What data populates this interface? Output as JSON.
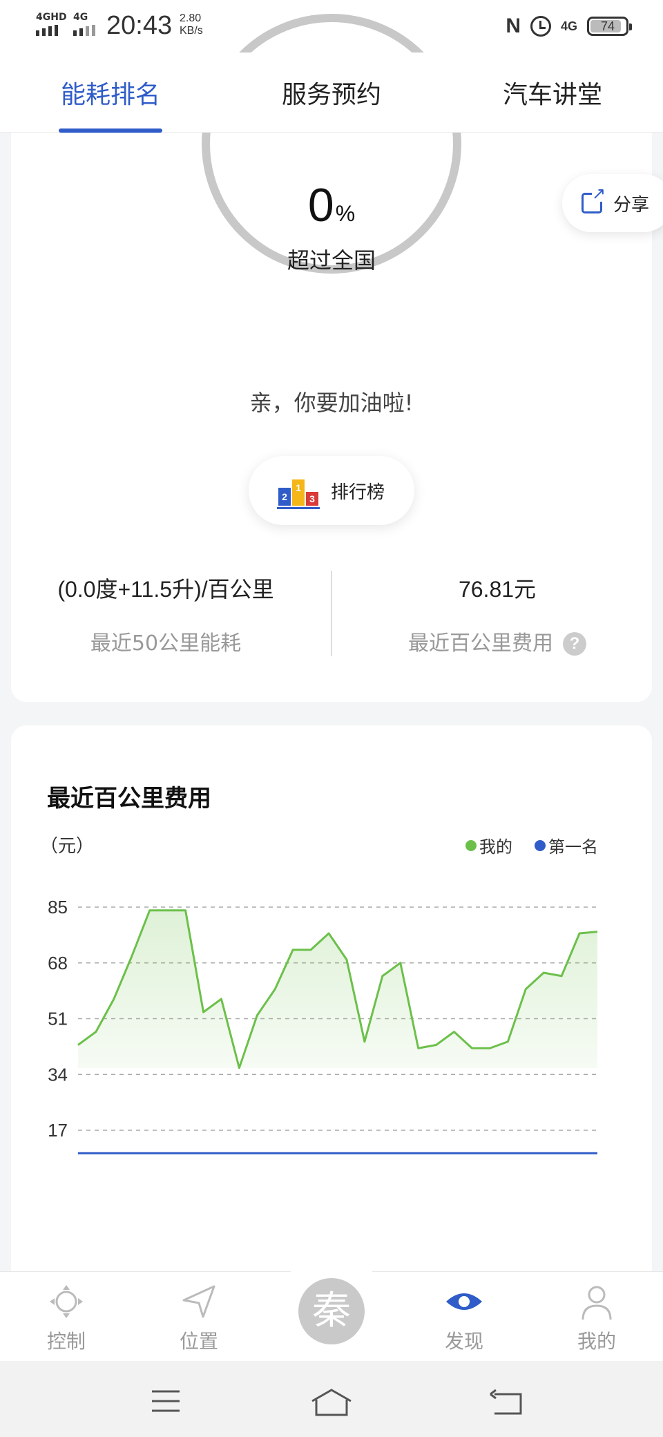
{
  "status_bar": {
    "net1": "4GHD",
    "net2": "4G",
    "time": "20:43",
    "speed_value": "2.80",
    "speed_unit": "KB/s",
    "net3": "4G",
    "battery": "74"
  },
  "tabs": [
    {
      "label": "能耗排名",
      "active": true
    },
    {
      "label": "服务预约",
      "active": false
    },
    {
      "label": "汽车讲堂",
      "active": false
    }
  ],
  "rank": {
    "percent": "0",
    "percent_sign": "%",
    "label": "超过全国",
    "progress_fraction": 0,
    "encourage": "亲，你要加油啦!"
  },
  "share": {
    "label": "分享",
    "icon": "share-icon"
  },
  "leaderboard": {
    "label": "排行榜",
    "icon": "podium-icon",
    "podium": [
      "2",
      "1",
      "3"
    ]
  },
  "stats": {
    "consumption_value": "(0.0度+11.5升)/百公里",
    "consumption_label": "最近50公里能耗",
    "cost_value": "76.81元",
    "cost_label": "最近百公里费用",
    "help_icon": "?"
  },
  "chart_section": {
    "title": "最近百公里费用",
    "unit": "（元）"
  },
  "chart_data": {
    "type": "area",
    "title": "最近百公里费用",
    "ylabel": "（元）",
    "xlabel": "",
    "yticks": [
      85,
      68,
      51,
      34,
      17
    ],
    "ylim": [
      0,
      85
    ],
    "grid": true,
    "legend_position": "top-right",
    "series": [
      {
        "name": "我的",
        "color": "#6cc04a",
        "values": [
          43,
          47,
          57,
          70,
          84,
          84,
          84,
          53,
          57,
          36,
          52,
          60,
          72,
          72,
          77,
          69,
          44,
          64,
          68,
          42,
          43,
          47,
          42,
          42,
          44,
          60,
          65,
          64,
          77,
          77.5
        ]
      },
      {
        "name": "第一名",
        "color": "#2f5cc8",
        "values": [
          10,
          10,
          10,
          10,
          10,
          10,
          10,
          10,
          10,
          10,
          10,
          10,
          10,
          10,
          10,
          10,
          10,
          10,
          10,
          10,
          10,
          10,
          10,
          10,
          10,
          10,
          10,
          10,
          10,
          10
        ]
      }
    ]
  },
  "bottom_nav": [
    {
      "label": "控制",
      "icon": "control-icon",
      "active": false
    },
    {
      "label": "位置",
      "icon": "location-arrow-icon",
      "active": false
    },
    {
      "label": "秦",
      "icon": "brand-logo-icon",
      "active": false
    },
    {
      "label": "发现",
      "icon": "eye-icon",
      "active": true
    },
    {
      "label": "我的",
      "icon": "profile-icon",
      "active": false
    }
  ],
  "colors": {
    "accent": "#2f5cc8",
    "my_series": "#6cc04a",
    "ring": "#c8c8c8"
  }
}
